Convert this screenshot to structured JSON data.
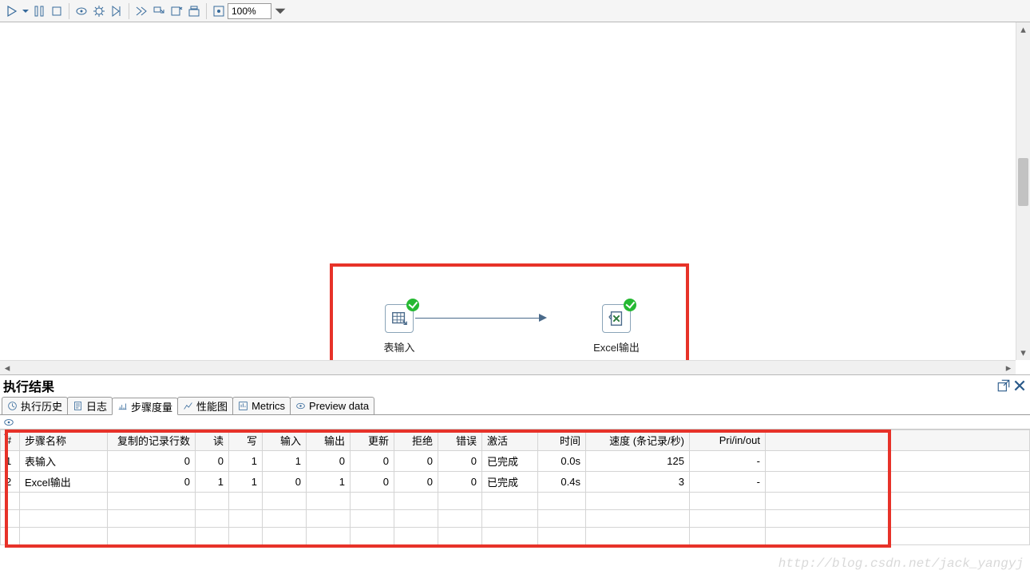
{
  "toolbar": {
    "zoom_value": "100%"
  },
  "canvas": {
    "node1_label": "表输入",
    "node2_label": "Excel输出"
  },
  "results": {
    "title": "执行结果",
    "tabs": [
      {
        "label": "执行历史"
      },
      {
        "label": "日志"
      },
      {
        "label": "步骤度量"
      },
      {
        "label": "性能图"
      },
      {
        "label": "Metrics"
      },
      {
        "label": "Preview data"
      }
    ],
    "columns": {
      "idx": "#",
      "name": "步骤名称",
      "copied": "复制的记录行数",
      "read": "读",
      "write": "写",
      "input": "输入",
      "output": "输出",
      "update": "更新",
      "reject": "拒绝",
      "error": "错误",
      "active": "激活",
      "time": "时间",
      "speed": "速度 (条记录/秒)",
      "prio": "Pri/in/out"
    },
    "rows": [
      {
        "idx": "1",
        "name": "表输入",
        "copied": "0",
        "read": "0",
        "write": "1",
        "input": "1",
        "output": "0",
        "update": "0",
        "reject": "0",
        "error": "0",
        "active": "已完成",
        "time": "0.0s",
        "speed": "125",
        "prio": "-"
      },
      {
        "idx": "2",
        "name": "Excel输出",
        "copied": "0",
        "read": "1",
        "write": "1",
        "input": "0",
        "output": "1",
        "update": "0",
        "reject": "0",
        "error": "0",
        "active": "已完成",
        "time": "0.4s",
        "speed": "3",
        "prio": "-"
      }
    ]
  },
  "watermark": "http://blog.csdn.net/jack_yangyj"
}
